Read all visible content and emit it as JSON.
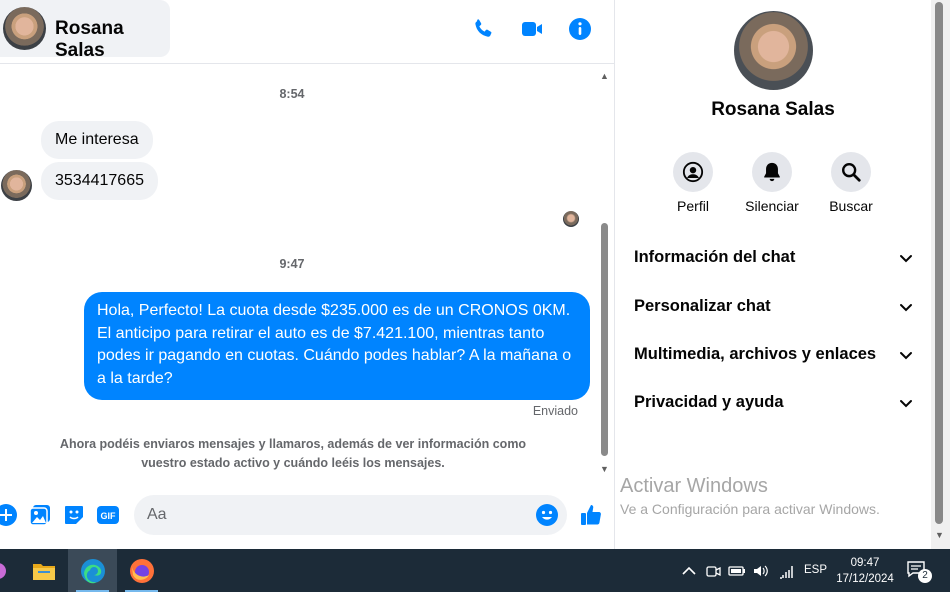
{
  "header": {
    "contact_name": "Rosana Salas",
    "icons": [
      "phone-icon",
      "video-camera-icon",
      "info-icon"
    ],
    "accent": "#0084ff"
  },
  "messages": {
    "timestamp_1": "8:54",
    "incoming": [
      "Me interesa",
      "3534417665"
    ],
    "timestamp_2": "9:47",
    "outgoing": "Hola, Perfecto! La cuota desde $235.000 es de un CRONOS 0KM. El anticipo para retirar el auto es de $7.421.100, mientras tanto podes ir pagando en cuotas. Cuándo podes hablar? A la mañana o a la tarde?",
    "sent_status": "Enviado",
    "info_note": "Ahora podéis enviaros mensajes y llamaros, además de ver información como vuestro estado activo y cuándo leéis los mensajes."
  },
  "composer": {
    "placeholder": "Aa",
    "icons": [
      "plus-icon",
      "image-icon",
      "sticker-icon",
      "gif-icon",
      "emoji-icon",
      "thumbs-up-icon"
    ],
    "gif_label": "GIF"
  },
  "panel": {
    "name": "Rosana Salas",
    "actions": [
      {
        "label": "Perfil",
        "icon": "profile-icon"
      },
      {
        "label": "Silenciar",
        "icon": "bell-icon"
      },
      {
        "label": "Buscar",
        "icon": "search-icon"
      }
    ],
    "sections": [
      "Información del chat",
      "Personalizar chat",
      "Multimedia, archivos y enlaces",
      "Privacidad y ayuda"
    ]
  },
  "watermark": {
    "title": "Activar Windows",
    "subtitle": "Ve a Configuración para activar Windows."
  },
  "taskbar": {
    "apps": [
      "file-explorer-icon",
      "edge-icon",
      "firefox-icon"
    ],
    "language": "ESP",
    "time": "09:47",
    "date": "17/12/2024",
    "notification_count": "2"
  }
}
